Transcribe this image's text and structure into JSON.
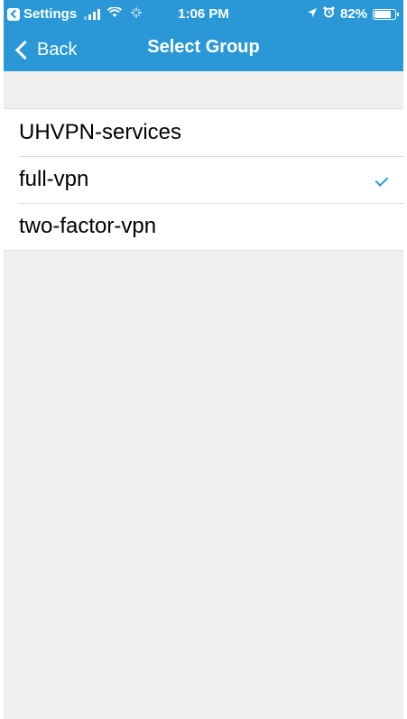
{
  "status_bar": {
    "back_app": "Settings",
    "time": "1:06 PM",
    "battery_percent": "82%",
    "battery_level": 0.82,
    "icons": [
      "settings-back-icon",
      "signal-icon",
      "wifi-icon",
      "activity-spinner-icon",
      "location-arrow-icon",
      "alarm-icon",
      "battery-icon"
    ]
  },
  "nav": {
    "back_label": "Back",
    "title": "Select Group"
  },
  "groups": [
    {
      "label": "UHVPN-services",
      "selected": false
    },
    {
      "label": "full-vpn",
      "selected": true
    },
    {
      "label": "two-factor-vpn",
      "selected": false
    }
  ],
  "colors": {
    "accent": "#2a98d6",
    "background": "#efefef"
  }
}
